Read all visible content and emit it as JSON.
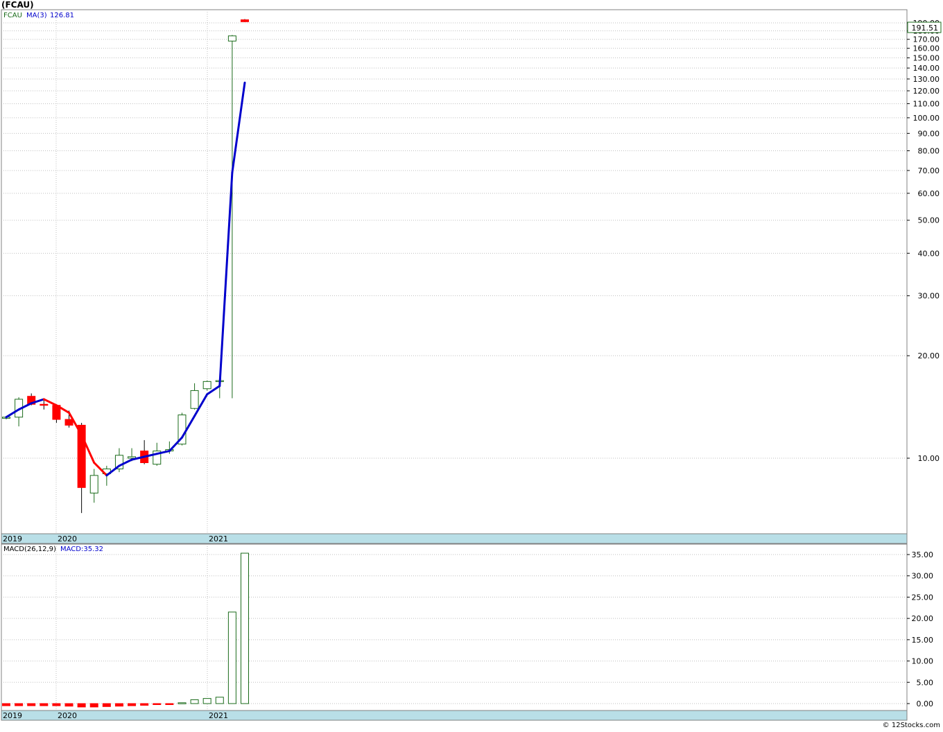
{
  "title": "(FCAU)",
  "copyright": "© 12Stocks.com",
  "colors": {
    "up": "#1a6b1a",
    "down": "#ff0000",
    "ma": "#0000cc",
    "ma_down": "#ff0000",
    "axis_band": "#b9dfe7",
    "grid": "#bfbfbf",
    "price_box": "#1a6b1a"
  },
  "chart_data": [
    {
      "type": "candlestick",
      "scale": "log",
      "legend": {
        "symbol": "FCAU",
        "ma_label": "MA(3)",
        "ma_value": "126.81"
      },
      "last_price": "191.51",
      "y_ticks": [
        "10.00",
        "20.00",
        "30.00",
        "40.00",
        "50.00",
        "60.00",
        "70.00",
        "80.00",
        "90.00",
        "100.00",
        "110.00",
        "120.00",
        "130.00",
        "140.00",
        "150.00",
        "160.00",
        "170.00",
        "180.00",
        "190.00"
      ],
      "x_labels": [
        "2019",
        "2020",
        "2021"
      ],
      "grid": true,
      "candles": [
        {
          "date": "2019-10",
          "o": 13.1,
          "h": 13.3,
          "l": 13.0,
          "c": 13.2
        },
        {
          "date": "2019-11",
          "o": 13.2,
          "h": 15.1,
          "l": 12.4,
          "c": 14.9
        },
        {
          "date": "2019-12",
          "o": 15.2,
          "h": 15.5,
          "l": 14.3,
          "c": 14.4
        },
        {
          "date": "2020-01",
          "o": 14.4,
          "h": 14.9,
          "l": 13.9,
          "c": 14.3
        },
        {
          "date": "2020-02",
          "o": 14.3,
          "h": 14.4,
          "l": 12.7,
          "c": 13.0
        },
        {
          "date": "2020-03",
          "o": 13.0,
          "h": 13.8,
          "l": 12.3,
          "c": 12.5
        },
        {
          "date": "2020-03b",
          "o": 12.5,
          "h": 12.7,
          "l": 6.9,
          "c": 8.2
        },
        {
          "date": "2020-04",
          "o": 7.9,
          "h": 9.3,
          "l": 7.4,
          "c": 8.9
        },
        {
          "date": "2020-05",
          "o": 9.0,
          "h": 9.5,
          "l": 8.3,
          "c": 9.3
        },
        {
          "date": "2020-06",
          "o": 9.3,
          "h": 10.7,
          "l": 9.1,
          "c": 10.2
        },
        {
          "date": "2020-07",
          "o": 10.0,
          "h": 10.7,
          "l": 9.8,
          "c": 10.1
        },
        {
          "date": "2020-08",
          "o": 10.5,
          "h": 11.3,
          "l": 9.6,
          "c": 9.7
        },
        {
          "date": "2020-09",
          "o": 9.6,
          "h": 11.1,
          "l": 9.5,
          "c": 10.5
        },
        {
          "date": "2020-10",
          "o": 10.5,
          "h": 11.2,
          "l": 10.3,
          "c": 10.6
        },
        {
          "date": "2020-11",
          "o": 11.0,
          "h": 13.6,
          "l": 10.9,
          "c": 13.4
        },
        {
          "date": "2020-12",
          "o": 14.0,
          "h": 16.6,
          "l": 13.9,
          "c": 15.8
        },
        {
          "date": "2021-01",
          "o": 16.0,
          "h": 16.9,
          "l": 15.8,
          "c": 16.8
        },
        {
          "date": "2021-01b",
          "o": 16.9,
          "h": 16.9,
          "l": 15.0,
          "c": 16.9
        },
        {
          "date": "2021-02",
          "o": 168.0,
          "h": 175.0,
          "l": 15.0,
          "c": 174.0
        },
        {
          "date": "2021-03",
          "o": 194.0,
          "h": 195.0,
          "l": 191.0,
          "c": 191.5
        }
      ],
      "ma": [
        13.2,
        13.9,
        14.5,
        14.9,
        14.3,
        13.6,
        11.7,
        9.7,
        8.9,
        9.5,
        9.9,
        10.1,
        10.3,
        10.5,
        11.5,
        13.3,
        15.4,
        16.3,
        69.0,
        126.81
      ]
    },
    {
      "type": "bar",
      "legend": {
        "name": "MACD(26,12,9)",
        "value_label": "MACD:35.32"
      },
      "y_ticks": [
        "0.00",
        "5.00",
        "10.00",
        "15.00",
        "20.00",
        "25.00",
        "30.00",
        "35.00"
      ],
      "x_labels": [
        "2019",
        "2020",
        "2021"
      ],
      "grid": true,
      "values": [
        -0.5,
        -0.5,
        -0.5,
        -0.5,
        -0.5,
        -0.6,
        -0.8,
        -0.8,
        -0.7,
        -0.6,
        -0.5,
        -0.4,
        -0.2,
        -0.1,
        0.2,
        0.9,
        1.2,
        1.5,
        21.5,
        35.32
      ]
    }
  ]
}
